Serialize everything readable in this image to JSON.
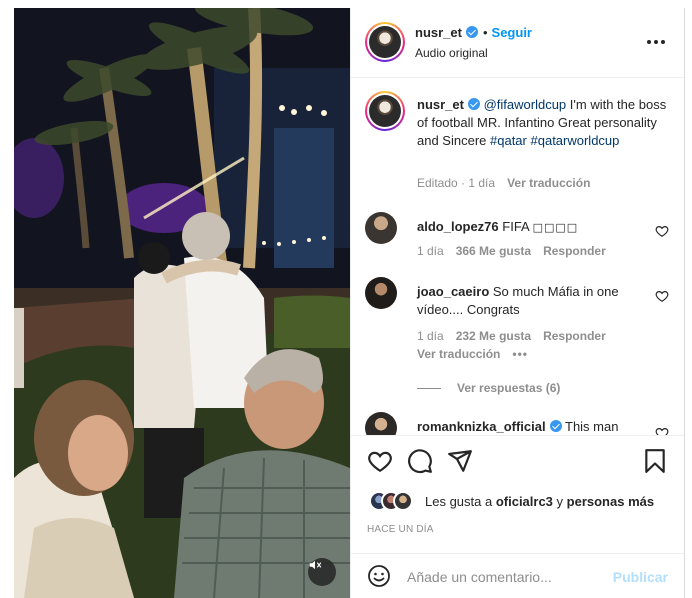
{
  "post": {
    "author": "nusr_et",
    "follow_label": "Seguir",
    "audio_label": "Audio original"
  },
  "caption": {
    "author": "nusr_et",
    "mention": "@fifaworldcup",
    "text": " I'm with the boss of football MR. Infantino Great personality and Sincere ",
    "hashtag_1": "#qatar",
    "hashtag_2": "#qatarworldcup",
    "edited": "Editado · 1 día",
    "translate": "Ver traducción"
  },
  "comments": [
    {
      "user": "aldo_lopez76",
      "text": "FIFA ",
      "glyphs": "□□□□",
      "time": "1 día",
      "likes": "366 Me gusta",
      "reply": "Responder"
    },
    {
      "user": "joao_caeiro",
      "text": "So much Máfia in one vídeo.... Congrats",
      "time": "1 día",
      "likes": "232 Me gusta",
      "reply": "Responder",
      "translate": "Ver traducción"
    },
    {
      "user": "romanknizka_official",
      "text": "This man"
    }
  ],
  "view_replies": "Ver respuestas (6)",
  "likes": {
    "prefix": "Les gusta a ",
    "user": "oficialrc3",
    "middle": " y ",
    "others": "personas más"
  },
  "time_ago": "Hace un día",
  "add_comment": {
    "placeholder": "Añade un comentario...",
    "publish": "Publicar"
  },
  "icons": {
    "verified": "verified-badge-icon",
    "more": "more-options-icon",
    "heart": "heart-icon",
    "comment": "comment-icon",
    "share": "share-icon",
    "save": "bookmark-icon",
    "emoji": "emoji-icon",
    "mute": "mute-icon"
  },
  "colors": {
    "accent": "#0095f6",
    "link": "#00376b",
    "muted": "#8e8e8e",
    "publish_disabled": "#b2dffc",
    "verified": "#3897f0"
  }
}
